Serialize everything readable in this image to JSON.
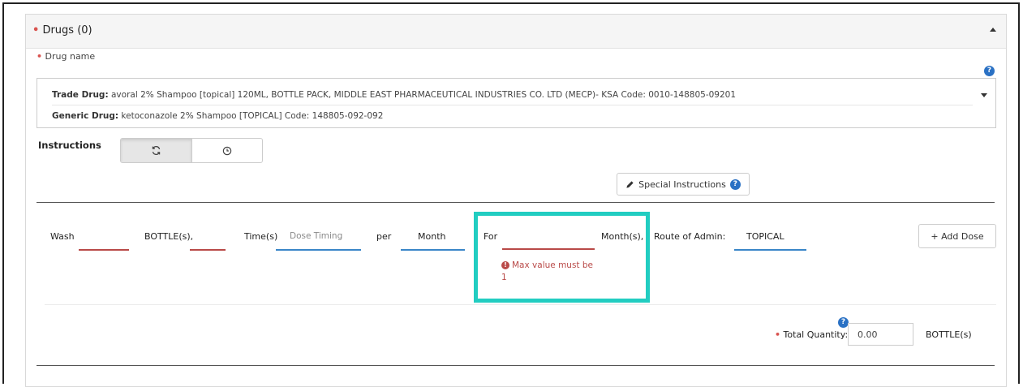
{
  "panel": {
    "title": "Drugs (0)"
  },
  "drug_name": {
    "label": "Drug name",
    "help_icon": "question-circle-icon",
    "trade_label": "Trade Drug:",
    "trade_value": " avoral 2% Shampoo [topical] 120ML, BOTTLE PACK, MIDDLE EAST PHARMACEUTICAL INDUSTRIES CO. LTD (MECP)- KSA Code: 0010-148805-09201",
    "generic_label": "Generic Drug:",
    "generic_value": " ketoconazole 2% Shampoo [TOPICAL] Code: 148805-092-092"
  },
  "instructions": {
    "label": "Instructions",
    "toggle_icons": [
      "refresh-icon",
      "clock-icon"
    ],
    "special_button": "Special Instructions"
  },
  "dose": {
    "verb": "Wash",
    "quantity_value": "",
    "unit": "BOTTLE(s),",
    "times_value": "",
    "times_label": "Time(s)",
    "dose_timing_placeholder": "Dose Timing",
    "per_label": "per",
    "period": "Month",
    "for_label": "For",
    "for_value": "",
    "months_label": "Month(s),",
    "route_label": "Route of Admin:",
    "route_value": "TOPICAL",
    "add_dose_button": "+ Add Dose",
    "error_message": "Max value must be 1"
  },
  "total": {
    "label": "Total Quantity:",
    "value": "0.00",
    "unit": "BOTTLE(s)"
  },
  "colors": {
    "highlight": "#22cdc1",
    "error": "#b94a48",
    "help": "#2a71c4",
    "input_underline": "#3a86c8"
  }
}
